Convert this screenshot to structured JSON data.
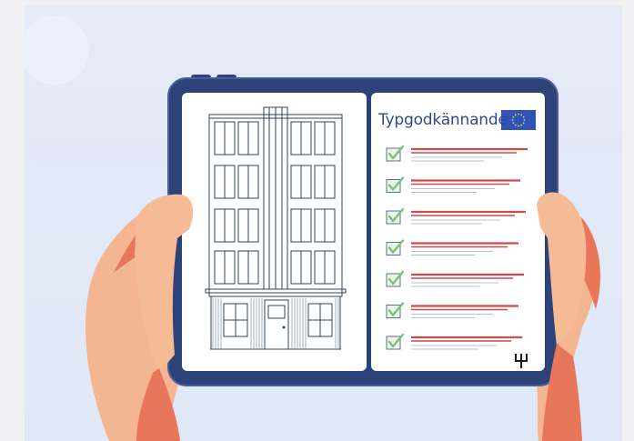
{
  "document": {
    "heading": "Typgodkännande",
    "flag_icon": "eu-flag-icon",
    "logo_icon": "trident-logo-icon",
    "check_icon": "checkbox-checked-icon"
  },
  "checklist": {
    "item_count": 7,
    "colors": {
      "checkbox_green": "#7cc07a",
      "checkbox_border": "#5a6e9a",
      "line_red": "#cc4b4b",
      "line_gray": "#b8c0d6"
    }
  },
  "colors": {
    "tablet_frame": "#2d4279",
    "screen": "#ffffff",
    "background": "#dde5f6",
    "skin": "#f4bb94",
    "skin_shadow": "#e8765a",
    "eu_blue": "#2f53b8",
    "eu_star": "#f3cc3f",
    "building_line": "#33415f"
  }
}
